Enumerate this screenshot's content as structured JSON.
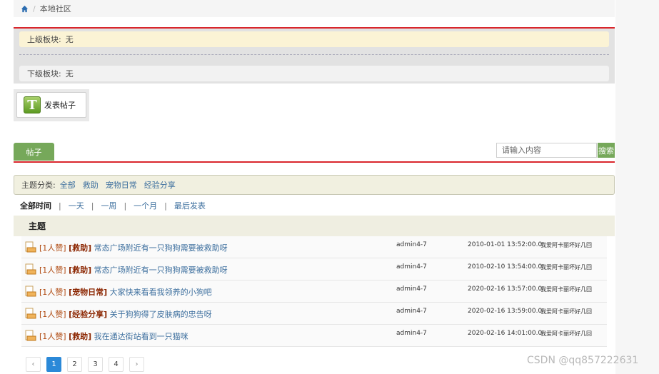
{
  "breadcrumb": {
    "home_icon": "home-icon",
    "separator": "/",
    "current": "本地社区"
  },
  "blocks": {
    "parent_label": "上级板块:",
    "parent_value": "无",
    "child_label": "下级板块:",
    "child_value": "无"
  },
  "post_button": {
    "icon": "T",
    "label": "发表帖子"
  },
  "tabs": {
    "posts": "帖子"
  },
  "search": {
    "placeholder": "请输入内容",
    "button": "搜索"
  },
  "categories": {
    "label": "主题分类:",
    "items": [
      "全部",
      "救助",
      "宠物日常",
      "经验分享"
    ]
  },
  "time_filter": {
    "current": "全部时间",
    "items": [
      "一天",
      "一周",
      "一个月",
      "最后发表"
    ],
    "separator": "|"
  },
  "table": {
    "header": "主题",
    "rows": [
      {
        "tag": "[1人赞]",
        "category": "[救助]",
        "title": "常态广场附近有一只狗狗需要被救助呀",
        "author": "admin4-7",
        "time": "2010-01-01 13:52:00.0",
        "last": "我爱阿卡丽坏好几回"
      },
      {
        "tag": "[1人赞]",
        "category": "[救助]",
        "title": "常态广场附近有一只狗狗需要被救助呀",
        "author": "admin4-7",
        "time": "2010-02-10 13:54:00.0",
        "last": "我爱阿卡丽坏好几回"
      },
      {
        "tag": "[1人赞]",
        "category": "[宠物日常]",
        "title": "大家快来看看我领养的小狗吧",
        "author": "admin4-7",
        "time": "2020-02-16 13:57:00.0",
        "last": "我爱阿卡丽坏好几回"
      },
      {
        "tag": "[1人赞]",
        "category": "[经验分享]",
        "title": "关于狗狗得了皮肤病的忠告呀",
        "author": "admin4-7",
        "time": "2020-02-16 13:59:00.0",
        "last": "我爱阿卡丽坏好几回"
      },
      {
        "tag": "[1人赞]",
        "category": "[救助]",
        "title": "我在通达街站看到一只猫咪",
        "author": "admin4-7",
        "time": "2020-02-16 14:01:00.0",
        "last": "我爱阿卡丽坏好几回"
      }
    ]
  },
  "pagination": {
    "prev": "‹",
    "pages": [
      "1",
      "2",
      "3",
      "4"
    ],
    "next": "›",
    "current": "1"
  },
  "watermark": "CSDN @qq857222631",
  "colors": {
    "accent_red": "#d9262c",
    "green": "#76a85a",
    "link_blue": "#3d6f9e",
    "page_active": "#2b89d8"
  }
}
